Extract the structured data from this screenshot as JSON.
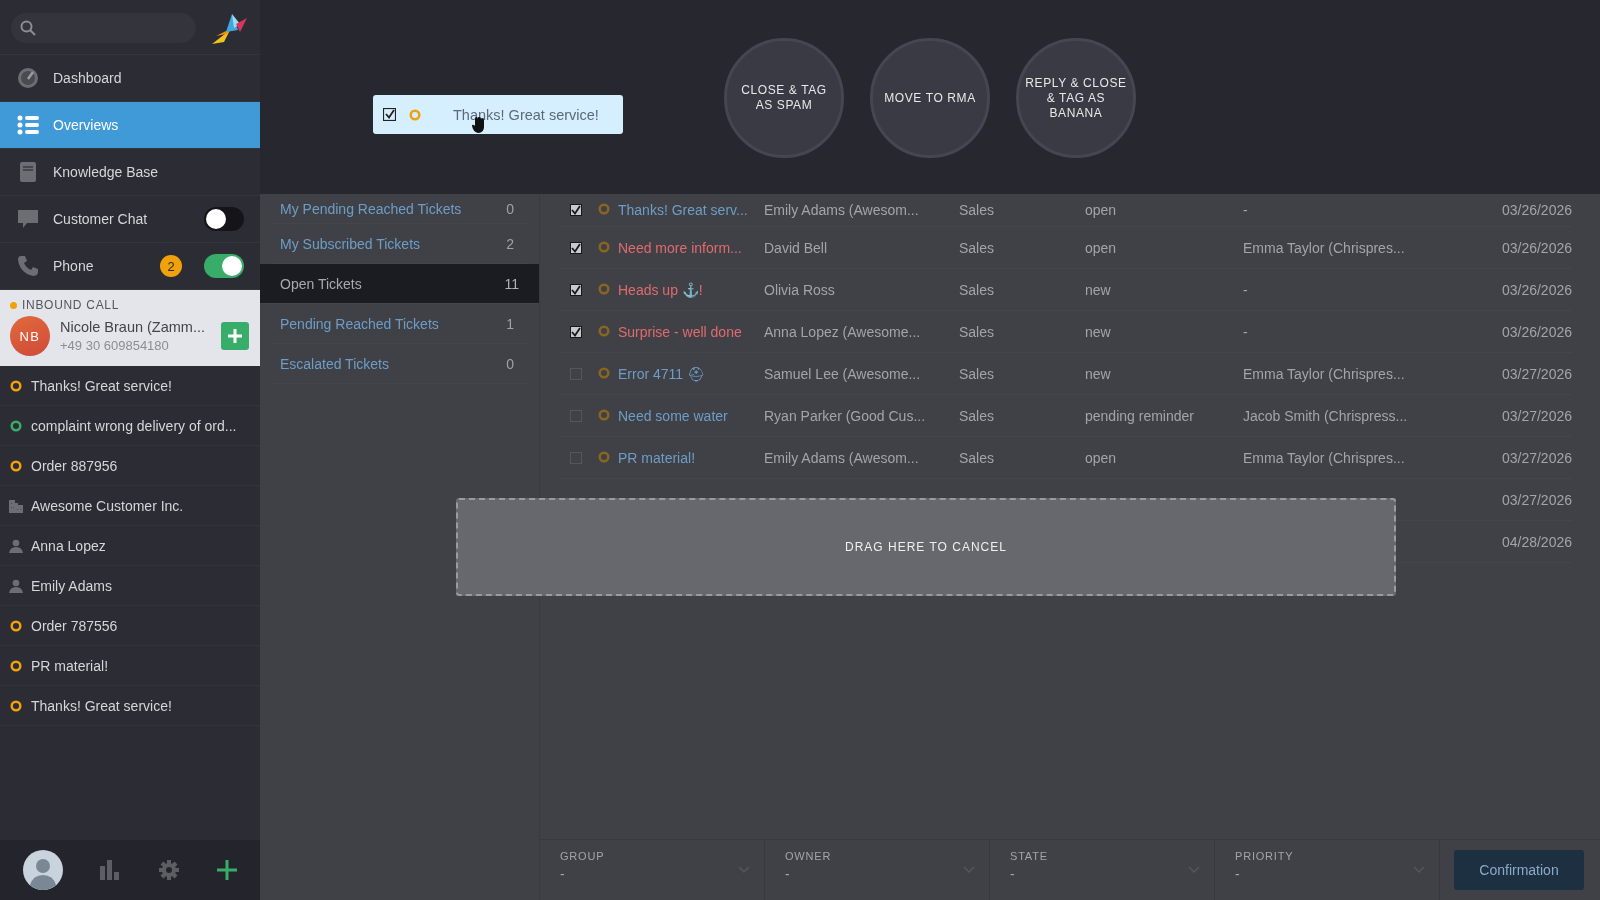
{
  "navigation": [
    {
      "label": "Dashboard",
      "kind": "dashboard",
      "selected": false
    },
    {
      "label": "Overviews",
      "kind": "overviews",
      "selected": true
    },
    {
      "label": "Knowledge Base",
      "kind": "knowledge",
      "selected": false
    },
    {
      "label": "Customer Chat",
      "kind": "chat",
      "selected": false,
      "on": false
    },
    {
      "label": "Phone",
      "kind": "phone",
      "selected": false,
      "badge": "2",
      "on": true
    }
  ],
  "inbound_call": {
    "title": "INBOUND CALL",
    "initials": "NB",
    "name": "Nicole Braun (Zamm...",
    "number": "+49 30 609854180"
  },
  "tasks": [
    {
      "kind": "ticket",
      "label": "Thanks! Great service!",
      "color": "#f0a10b"
    },
    {
      "kind": "ticket",
      "label": "complaint wrong delivery of ord...",
      "color": "#38ad69"
    },
    {
      "kind": "ticket",
      "label": "Order 887956",
      "color": "#f0a10b"
    },
    {
      "kind": "organization",
      "label": "Awesome Customer Inc."
    },
    {
      "kind": "user",
      "label": "Anna Lopez"
    },
    {
      "kind": "user",
      "label": "Emily Adams"
    },
    {
      "kind": "ticket",
      "label": "Order 787556",
      "color": "#f0a10b"
    },
    {
      "kind": "ticket",
      "label": "PR material!",
      "color": "#f0a10b"
    },
    {
      "kind": "ticket",
      "label": "Thanks! Great service!",
      "color": "#f0a10b"
    }
  ],
  "drag_item": {
    "checked": true,
    "title": "Thanks! Great service!"
  },
  "actions": [
    "CLOSE & TAG AS SPAM",
    "MOVE TO RMA",
    "REPLY & CLOSE & TAG AS BANANA"
  ],
  "overviews": [
    {
      "label": "My Pending Reached Tickets",
      "count": "0",
      "selected": false
    },
    {
      "label": "My Subscribed Tickets",
      "count": "2",
      "selected": false
    },
    {
      "label": "Open Tickets",
      "count": "11",
      "selected": true
    },
    {
      "label": "Pending Reached Tickets",
      "count": "1",
      "selected": false
    },
    {
      "label": "Escalated Tickets",
      "count": "0",
      "selected": false
    }
  ],
  "tickets": [
    {
      "checked": true,
      "title": "Thanks! Great serv...",
      "escalated": false,
      "customer": "Emily Adams (Awesom...",
      "group": "Sales",
      "state": "open",
      "owner": "-",
      "date": "03/26/2026"
    },
    {
      "checked": true,
      "title": "Need more inform...",
      "escalated": true,
      "customer": "David Bell",
      "group": "Sales",
      "state": "open",
      "owner": "Emma Taylor (Chrispres...",
      "date": "03/26/2026"
    },
    {
      "checked": true,
      "title": "Heads up ⚓!",
      "escalated": true,
      "customer": "Olivia Ross",
      "group": "Sales",
      "state": "new",
      "owner": "-",
      "date": "03/26/2026"
    },
    {
      "checked": true,
      "title": "Surprise - well done",
      "escalated": true,
      "customer": "Anna Lopez (Awesome...",
      "group": "Sales",
      "state": "new",
      "owner": "-",
      "date": "03/26/2026"
    },
    {
      "checked": false,
      "title": "Error 4711 ⛑",
      "escalated": false,
      "customer": "Samuel Lee (Awesome...",
      "group": "Sales",
      "state": "new",
      "owner": "Emma Taylor (Chrispres...",
      "date": "03/27/2026"
    },
    {
      "checked": false,
      "title": "Need some water",
      "escalated": false,
      "customer": "Ryan Parker (Good Cus...",
      "group": "Sales",
      "state": "pending reminder",
      "owner": "Jacob Smith (Chrispress...",
      "date": "03/27/2026"
    },
    {
      "checked": false,
      "title": "PR material!",
      "escalated": false,
      "customer": "Emily Adams (Awesom...",
      "group": "Sales",
      "state": "open",
      "owner": "Emma Taylor (Chrispres...",
      "date": "03/27/2026"
    },
    {
      "date": "03/27/2026"
    },
    {
      "date": "04/28/2026"
    }
  ],
  "drop_zone": {
    "label": "DRAG HERE TO CANCEL"
  },
  "bulk": {
    "fields": [
      {
        "label": "GROUP",
        "value": "-"
      },
      {
        "label": "OWNER",
        "value": "-"
      },
      {
        "label": "STATE",
        "value": "-"
      },
      {
        "label": "PRIORITY",
        "value": "-"
      }
    ],
    "button": "Confirmation"
  }
}
